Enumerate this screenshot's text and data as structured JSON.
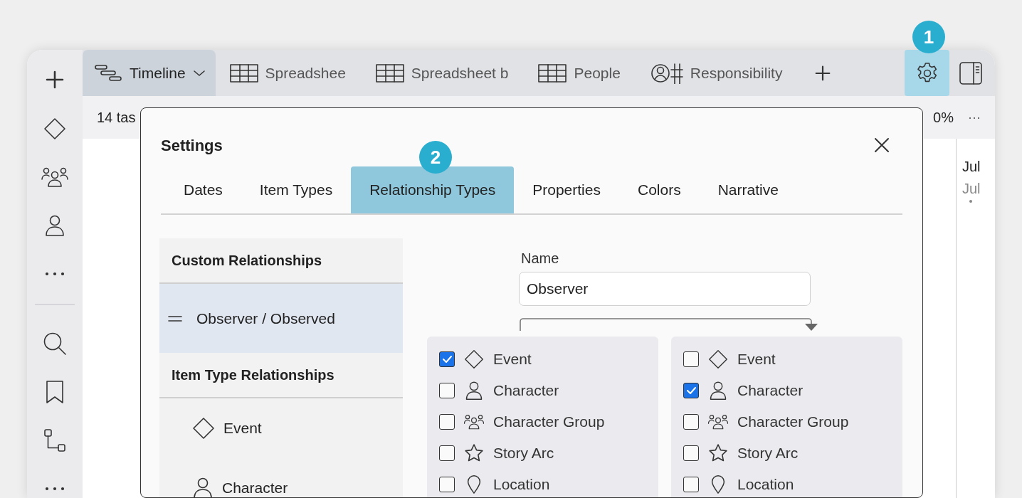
{
  "app_tabs": [
    {
      "label": "Timeline",
      "selected": true
    },
    {
      "label": "Spreadshee",
      "selected": false
    },
    {
      "label": "Spreadsheet b",
      "selected": false
    },
    {
      "label": "People",
      "selected": false
    },
    {
      "label": "Responsibility",
      "selected": false
    }
  ],
  "settings_button": {
    "selected": true
  },
  "callouts": [
    "1",
    "2"
  ],
  "toolbar": {
    "count": "14 tas",
    "zoom": "0%",
    "more": "···"
  },
  "timeline": {
    "month_labels": [
      "Jul",
      "Jul"
    ]
  },
  "dialog": {
    "title": "Settings",
    "tabs": [
      {
        "label": "Dates",
        "selected": false
      },
      {
        "label": "Item Types",
        "selected": false
      },
      {
        "label": "Relationship Types",
        "selected": true
      },
      {
        "label": "Properties",
        "selected": false
      },
      {
        "label": "Colors",
        "selected": false
      },
      {
        "label": "Narrative",
        "selected": false
      }
    ],
    "sections": [
      {
        "title": "Custom Relationships",
        "items": [
          {
            "label": "Observer / Observed",
            "selected": true
          }
        ]
      },
      {
        "title": "Item Type Relationships",
        "items": [
          {
            "label": "Event",
            "selected": false
          },
          {
            "label": "Character",
            "selected": false
          }
        ]
      }
    ],
    "name_label": "Name",
    "name_value": "Observer",
    "from_types": [
      {
        "label": "Event",
        "checked": true
      },
      {
        "label": "Character",
        "checked": false
      },
      {
        "label": "Character Group",
        "checked": false
      },
      {
        "label": "Story Arc",
        "checked": false
      },
      {
        "label": "Location",
        "checked": false
      }
    ],
    "to_types": [
      {
        "label": "Event",
        "checked": false
      },
      {
        "label": "Character",
        "checked": true
      },
      {
        "label": "Character Group",
        "checked": false
      },
      {
        "label": "Story Arc",
        "checked": false
      },
      {
        "label": "Location",
        "checked": false
      }
    ]
  }
}
